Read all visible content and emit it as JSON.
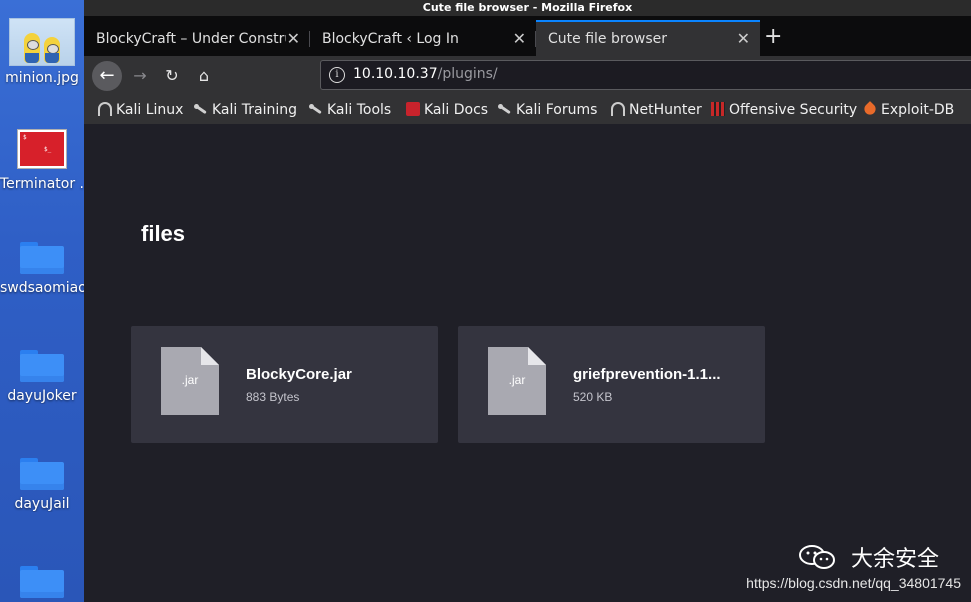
{
  "desktop": {
    "icons": [
      {
        "label": "minion.jpg",
        "type": "image"
      },
      {
        "label": "Terminator ...",
        "type": "terminal"
      },
      {
        "label": "swdsaomiao",
        "type": "folder"
      },
      {
        "label": "dayuJoker",
        "type": "folder"
      },
      {
        "label": "dayuJail",
        "type": "folder"
      },
      {
        "label": "",
        "type": "folder"
      }
    ]
  },
  "window": {
    "title": "Cute file browser - Mozilla Firefox"
  },
  "tabs": [
    {
      "label": "BlockyCraft – Under Constru",
      "active": false
    },
    {
      "label": "BlockyCraft ‹ Log In",
      "active": false
    },
    {
      "label": "Cute file browser",
      "active": true
    }
  ],
  "tab_close_glyph": "✕",
  "new_tab_glyph": "+",
  "nav": {
    "back": "←",
    "forward": "→",
    "reload": "↻",
    "home": "⌂"
  },
  "url": {
    "host": "10.10.10.37",
    "path": "/plugins/",
    "info_glyph": "i"
  },
  "bookmarks": [
    {
      "label": "Kali Linux",
      "icon": "nethunter-icon"
    },
    {
      "label": "Kali Training",
      "icon": "kali-dragon-icon"
    },
    {
      "label": "Kali Tools",
      "icon": "kali-dragon-icon"
    },
    {
      "label": "Kali Docs",
      "icon": "kali-docs-icon"
    },
    {
      "label": "Kali Forums",
      "icon": "kali-dragon-icon"
    },
    {
      "label": "NetHunter",
      "icon": "nethunter-icon"
    },
    {
      "label": "Offensive Security",
      "icon": "offsec-icon"
    },
    {
      "label": "Exploit-DB",
      "icon": "exploitdb-icon"
    }
  ],
  "page": {
    "title": "files",
    "files": [
      {
        "name": "BlockyCore.jar",
        "size": "883 Bytes",
        "ext": ".jar"
      },
      {
        "name": "griefprevention-1.1...",
        "size": "520 KB",
        "ext": ".jar"
      }
    ]
  },
  "watermark": {
    "brand": "大余安全",
    "url": "https://blog.csdn.net/qq_34801745"
  }
}
